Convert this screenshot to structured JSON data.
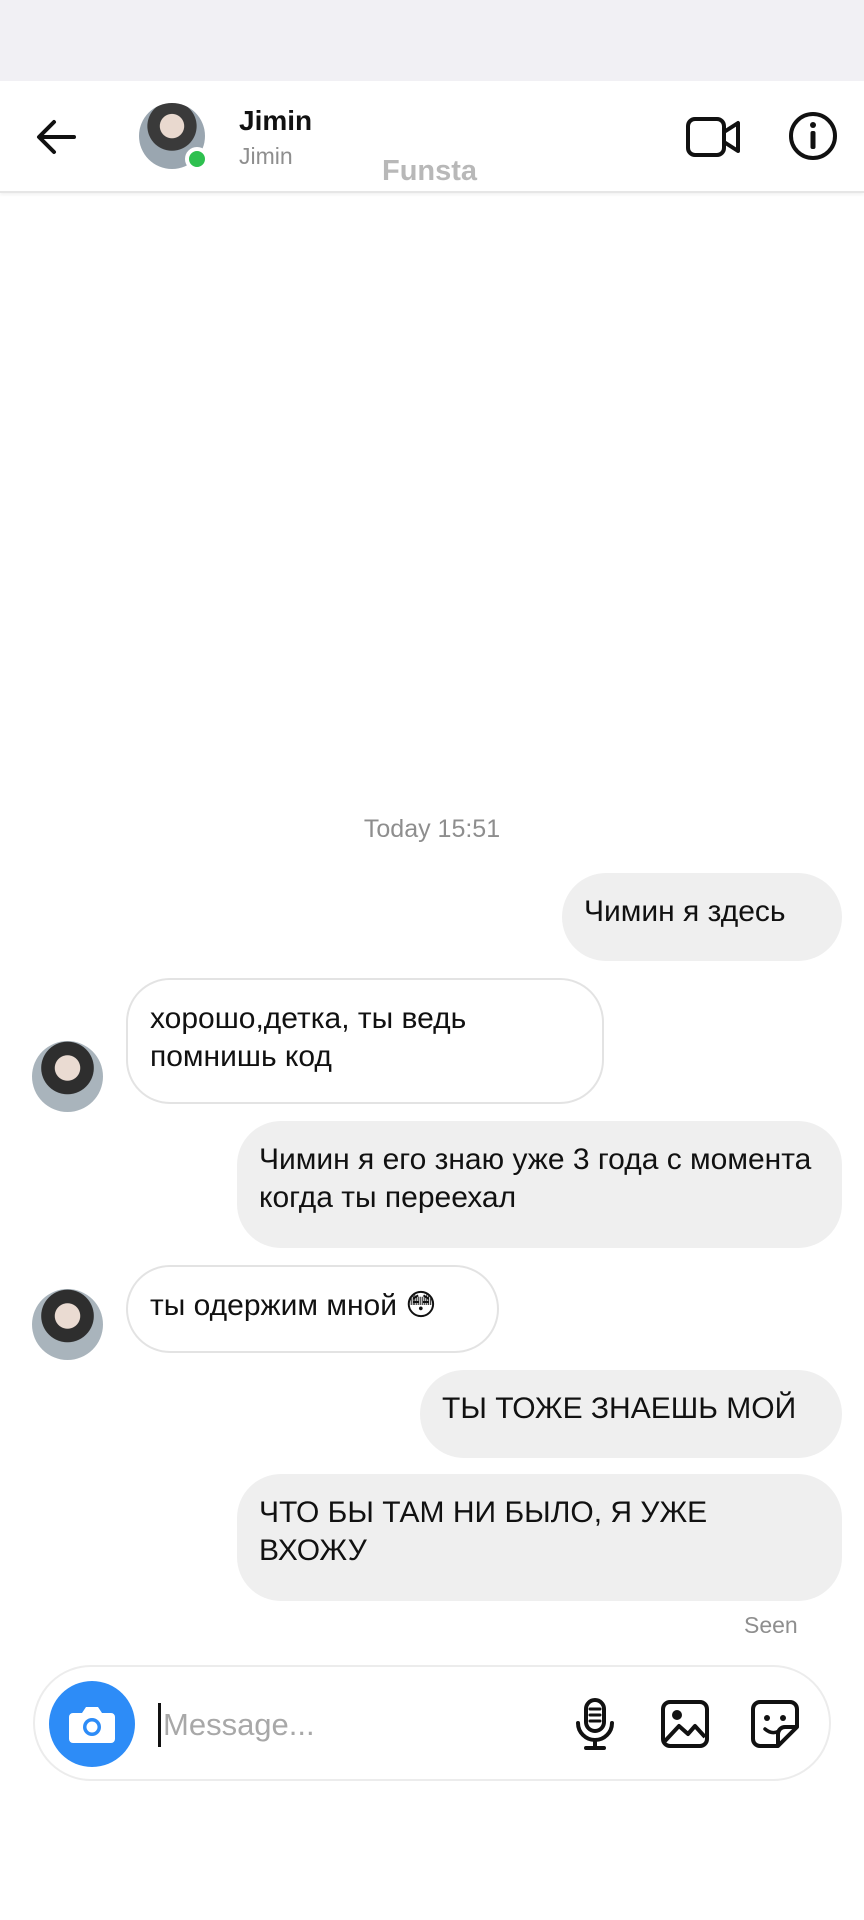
{
  "header": {
    "name": "Jimin",
    "username": "Jimin",
    "watermark": "Funsta"
  },
  "chat": {
    "timestamp": "Today 15:51",
    "messages": [
      {
        "direction": "out",
        "text": "Чимин я здесь"
      },
      {
        "direction": "in",
        "text": "хорошо,детка, ты ведь помнишь код"
      },
      {
        "direction": "out",
        "text": "Чимин я его знаю уже 3 года с момента когда ты переехал"
      },
      {
        "direction": "in",
        "text": "ты одержим мной 😳"
      },
      {
        "direction": "out",
        "text": "ТЫ ТОЖЕ ЗНАЕШЬ МОЙ"
      },
      {
        "direction": "out",
        "text": "ЧТО БЫ ТАМ НИ БЫЛО, Я УЖЕ ВХОЖУ"
      }
    ],
    "seen_label": "Seen"
  },
  "composer": {
    "placeholder": "Message..."
  },
  "icons": {
    "back": "arrow-left-icon",
    "video": "video-camera-icon",
    "info": "info-icon",
    "camera": "camera-icon",
    "mic": "microphone-icon",
    "gallery": "image-icon",
    "sticker": "sticker-icon"
  },
  "colors": {
    "online": "#2ec04f",
    "camera_button": "#2d8cf7",
    "outgoing_bubble": "#efefef"
  }
}
